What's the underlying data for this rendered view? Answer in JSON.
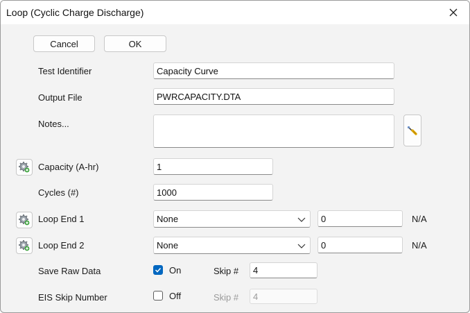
{
  "window": {
    "title": "Loop (Cyclic Charge Discharge)"
  },
  "buttons": {
    "cancel": "Cancel",
    "ok": "OK"
  },
  "form": {
    "test_identifier": {
      "label": "Test Identifier",
      "value": "Capacity Curve"
    },
    "output_file": {
      "label": "Output File",
      "value": "PWRCAPACITY.DTA"
    },
    "notes": {
      "label": "Notes...",
      "value": ""
    },
    "capacity": {
      "label": "Capacity (A-hr)",
      "value": "1"
    },
    "cycles": {
      "label": "Cycles (#)",
      "value": "1000"
    },
    "loop_end_1": {
      "label": "Loop End 1",
      "selected": "None",
      "value": "0",
      "unit": "N/A"
    },
    "loop_end_2": {
      "label": "Loop End 2",
      "selected": "None",
      "value": "0",
      "unit": "N/A"
    },
    "save_raw_data": {
      "label": "Save Raw Data",
      "checked": true,
      "state": "On",
      "skip_label": "Skip #",
      "skip_value": "4"
    },
    "eis_skip_number": {
      "label": "EIS Skip Number",
      "checked": false,
      "state": "Off",
      "skip_label": "Skip #",
      "skip_value": "4"
    }
  },
  "icons": {
    "close": "close-icon",
    "gear": "gear-icon",
    "tool": "screwdriver-icon",
    "chevron": "chevron-down-icon",
    "checkmark": "checkmark-icon"
  },
  "colors": {
    "accent": "#0067c0",
    "background": "#f3f3f3"
  }
}
